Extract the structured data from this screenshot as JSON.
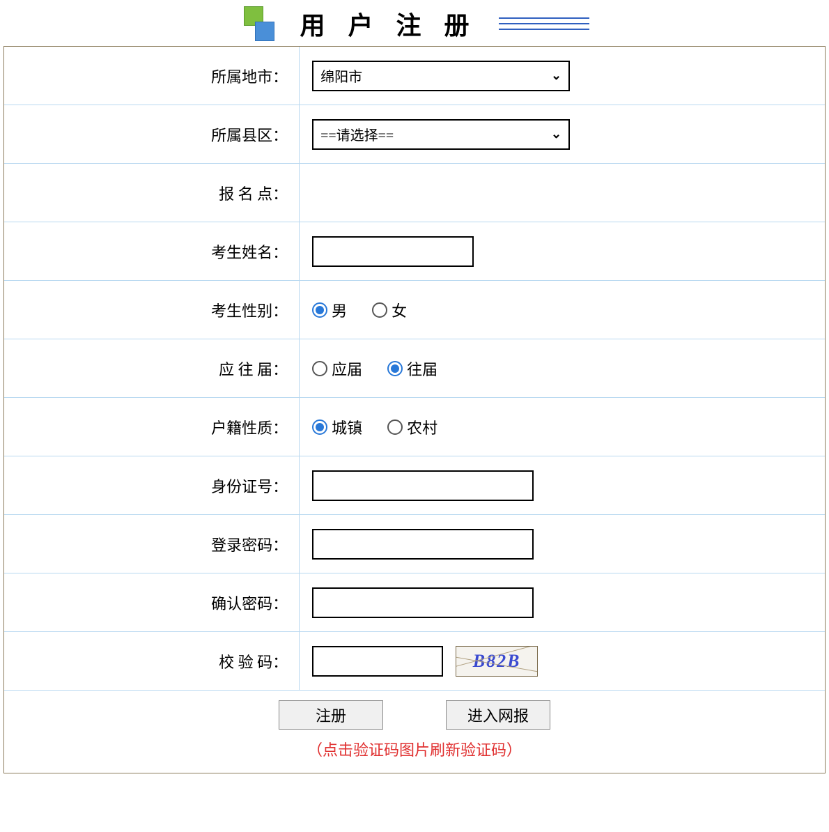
{
  "header": {
    "title": "用 户 注 册"
  },
  "form": {
    "city": {
      "label": "所属地市：",
      "value": "绵阳市"
    },
    "district": {
      "label": "所属县区：",
      "value": "==请选择=="
    },
    "site": {
      "label": "报 名 点："
    },
    "name": {
      "label": "考生姓名：",
      "value": ""
    },
    "gender": {
      "label": "考生性别：",
      "options": [
        {
          "label": "男",
          "checked": true
        },
        {
          "label": "女",
          "checked": false
        }
      ]
    },
    "gradType": {
      "label": "应 往 届：",
      "options": [
        {
          "label": "应届",
          "checked": false
        },
        {
          "label": "往届",
          "checked": true
        }
      ]
    },
    "residence": {
      "label": "户籍性质：",
      "options": [
        {
          "label": "城镇",
          "checked": true
        },
        {
          "label": "农村",
          "checked": false
        }
      ]
    },
    "idNumber": {
      "label": "身份证号：",
      "value": ""
    },
    "password": {
      "label": "登录密码：",
      "value": ""
    },
    "confirmPassword": {
      "label": "确认密码：",
      "value": ""
    },
    "captcha": {
      "label": "校 验 码：",
      "value": "",
      "image": "B82B"
    }
  },
  "buttons": {
    "register": "注册",
    "enter": "进入网报"
  },
  "hint": "（点击验证码图片刷新验证码）"
}
